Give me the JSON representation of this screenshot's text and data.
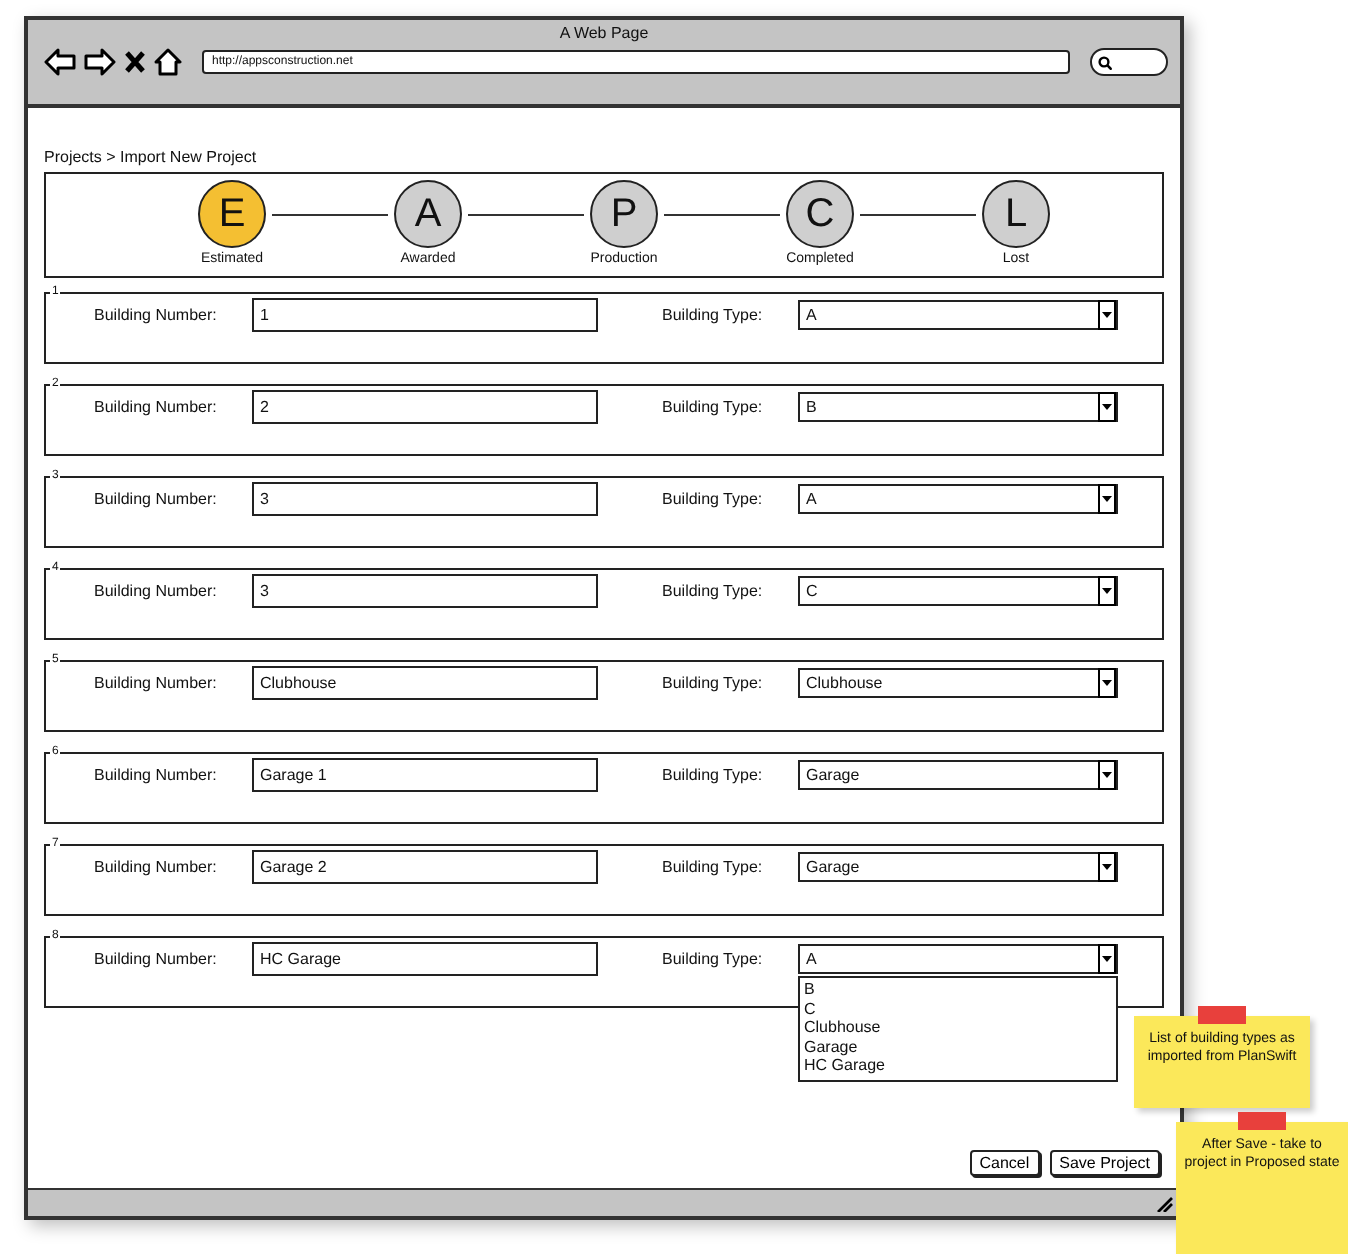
{
  "window": {
    "title": "A Web Page",
    "address": "http://appsconstruction.net"
  },
  "breadcrumb": "Projects > Import New Project",
  "steps": [
    {
      "letter": "E",
      "label": "Estimated",
      "selected": true
    },
    {
      "letter": "A",
      "label": "Awarded",
      "selected": false
    },
    {
      "letter": "P",
      "label": "Production",
      "selected": false
    },
    {
      "letter": "C",
      "label": "Completed",
      "selected": false
    },
    {
      "letter": "L",
      "label": "Lost",
      "selected": false
    }
  ],
  "buildings": [
    {
      "group": "1",
      "number_label": "Building Number:",
      "number": "1",
      "type_label": "Building Type:",
      "type": "A",
      "expanded": false
    },
    {
      "group": "2",
      "number_label": "Building Number:",
      "number": "2",
      "type_label": "Building Type:",
      "type": "B",
      "expanded": false
    },
    {
      "group": "3",
      "number_label": "Building Number:",
      "number": "3",
      "type_label": "Building Type:",
      "type": "A",
      "expanded": false
    },
    {
      "group": "4",
      "number_label": "Building Number:",
      "number": "3",
      "type_label": "Building Type:",
      "type": "C",
      "expanded": false
    },
    {
      "group": "5",
      "number_label": "Building Number:",
      "number": "Clubhouse",
      "type_label": "Building Type:",
      "type": "Clubhouse",
      "expanded": false
    },
    {
      "group": "6",
      "number_label": "Building Number:",
      "number": "Garage 1",
      "type_label": "Building Type:",
      "type": "Garage",
      "expanded": false
    },
    {
      "group": "7",
      "number_label": "Building Number:",
      "number": "Garage 2",
      "type_label": "Building Type:",
      "type": "Garage",
      "expanded": false
    },
    {
      "group": "8",
      "number_label": "Building Number:",
      "number": "HC Garage",
      "type_label": "Building Type:",
      "type": "A",
      "expanded": true,
      "options": [
        "B",
        "C",
        "Clubhouse",
        "Garage",
        "HC Garage"
      ]
    }
  ],
  "buttons": [
    "Cancel",
    "Save Project"
  ],
  "notes": [
    {
      "text": "List of building types as imported from PlanSwift"
    },
    {
      "text": "After Save - take to project in Proposed state"
    }
  ]
}
